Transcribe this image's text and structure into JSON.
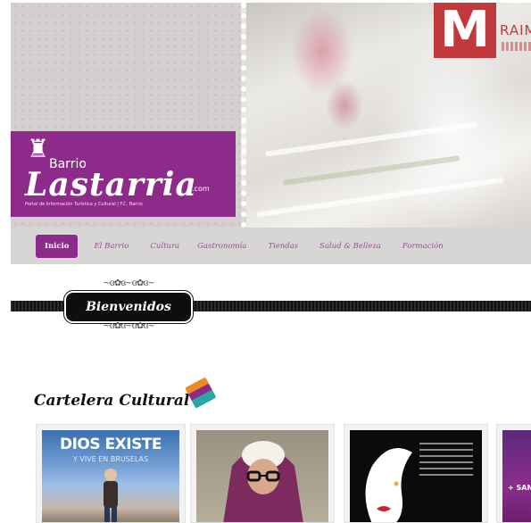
{
  "header": {
    "logo": {
      "barrio": "Barrio",
      "name": "Lastarria",
      "domain": ".com",
      "tagline": "Portal de Información Turística y Cultural | F.C. Barrio"
    },
    "sponsor": {
      "letter": "M",
      "name": "RAIM"
    }
  },
  "nav": {
    "items": [
      {
        "label": "Inicio"
      },
      {
        "label": "El Barrio"
      },
      {
        "label": "Cultura"
      },
      {
        "label": "Gastronomía"
      },
      {
        "label": "Tiendas"
      },
      {
        "label": "Salud & Belleza"
      },
      {
        "label": "Formación"
      }
    ]
  },
  "welcome": {
    "label": "Bienvenidos"
  },
  "cartelera": {
    "title": "Cartelera Cultural",
    "cards": [
      {
        "title": "DIOS EXISTE",
        "subtitle": "Y VIVE EN BRUSELAS"
      },
      {},
      {},
      {
        "label": "+ SAN"
      }
    ]
  },
  "colors": {
    "brand_purple": "#8e2b8a",
    "sponsor_red": "#c0393b",
    "ribbon_black": "#111111"
  }
}
